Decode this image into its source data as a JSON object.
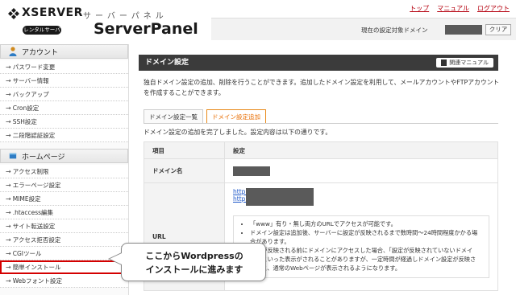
{
  "header": {
    "logo_text": "XSERVER",
    "logo_kana": "サーバーパネル",
    "logo_badge": "レンタルサーバー",
    "product_name": "ServerPanel",
    "top_links": [
      "トップ",
      "マニュアル",
      "ログアウト"
    ],
    "domain_label": "現在の設定対象ドメイン",
    "clear_button": "クリア"
  },
  "sidebar": {
    "account_section": "アカウント",
    "account_items": [
      "パスワード変更",
      "サーバー情報",
      "バックアップ",
      "Cron設定",
      "SSH設定",
      "二段階認証設定"
    ],
    "homepage_section": "ホームページ",
    "homepage_items": [
      "アクセス制限",
      "エラーページ設定",
      "MIME設定",
      ".htaccess編集",
      "サイト転送設定",
      "アクセス拒否設定",
      "CGIツール",
      "簡単インストール",
      "Webフォント設定"
    ]
  },
  "main": {
    "title": "ドメイン設定",
    "manual_button": "関連マニュアル",
    "description": "独自ドメイン設定の追加、削除を行うことができます。追加したドメイン設定を利用して、メールアカウントやFTPアカウントを作成することができます。",
    "tabs": [
      "ドメイン設定一覧",
      "ドメイン設定追加"
    ],
    "complete_message": "ドメイン設定の追加を完了しました。設定内容は以下の通りです。",
    "table": {
      "col_item": "項目",
      "col_setting": "設定",
      "row_domain": "ドメイン名",
      "row_url": "URL",
      "url_prefix_1": "http://",
      "url_prefix_2": "http://",
      "notes": [
        "「www」有り・無し両方のURLでアクセスが可能です。",
        "ドメイン設定は追加後、サーバーに設定が反映されるまで数時間～24時間程度かかる場合があります。",
        "設定が反映される前にドメインにアクセスした場合、「設定が反映されていないドメイン」といった表示がされることがありますが、一定時間が経過しドメイン設定が反映されると、通常のWebページが表示されるようになります。"
      ]
    }
  },
  "callout": {
    "line1": "ここからWordpressの",
    "line2": "インストールに進みます"
  },
  "colors": {
    "accent_red": "#b5000e",
    "title_bar": "#3b3b3b",
    "active_tab": "#e86d00",
    "highlight_box": "#d40000",
    "link_blue": "#1a55c8"
  }
}
